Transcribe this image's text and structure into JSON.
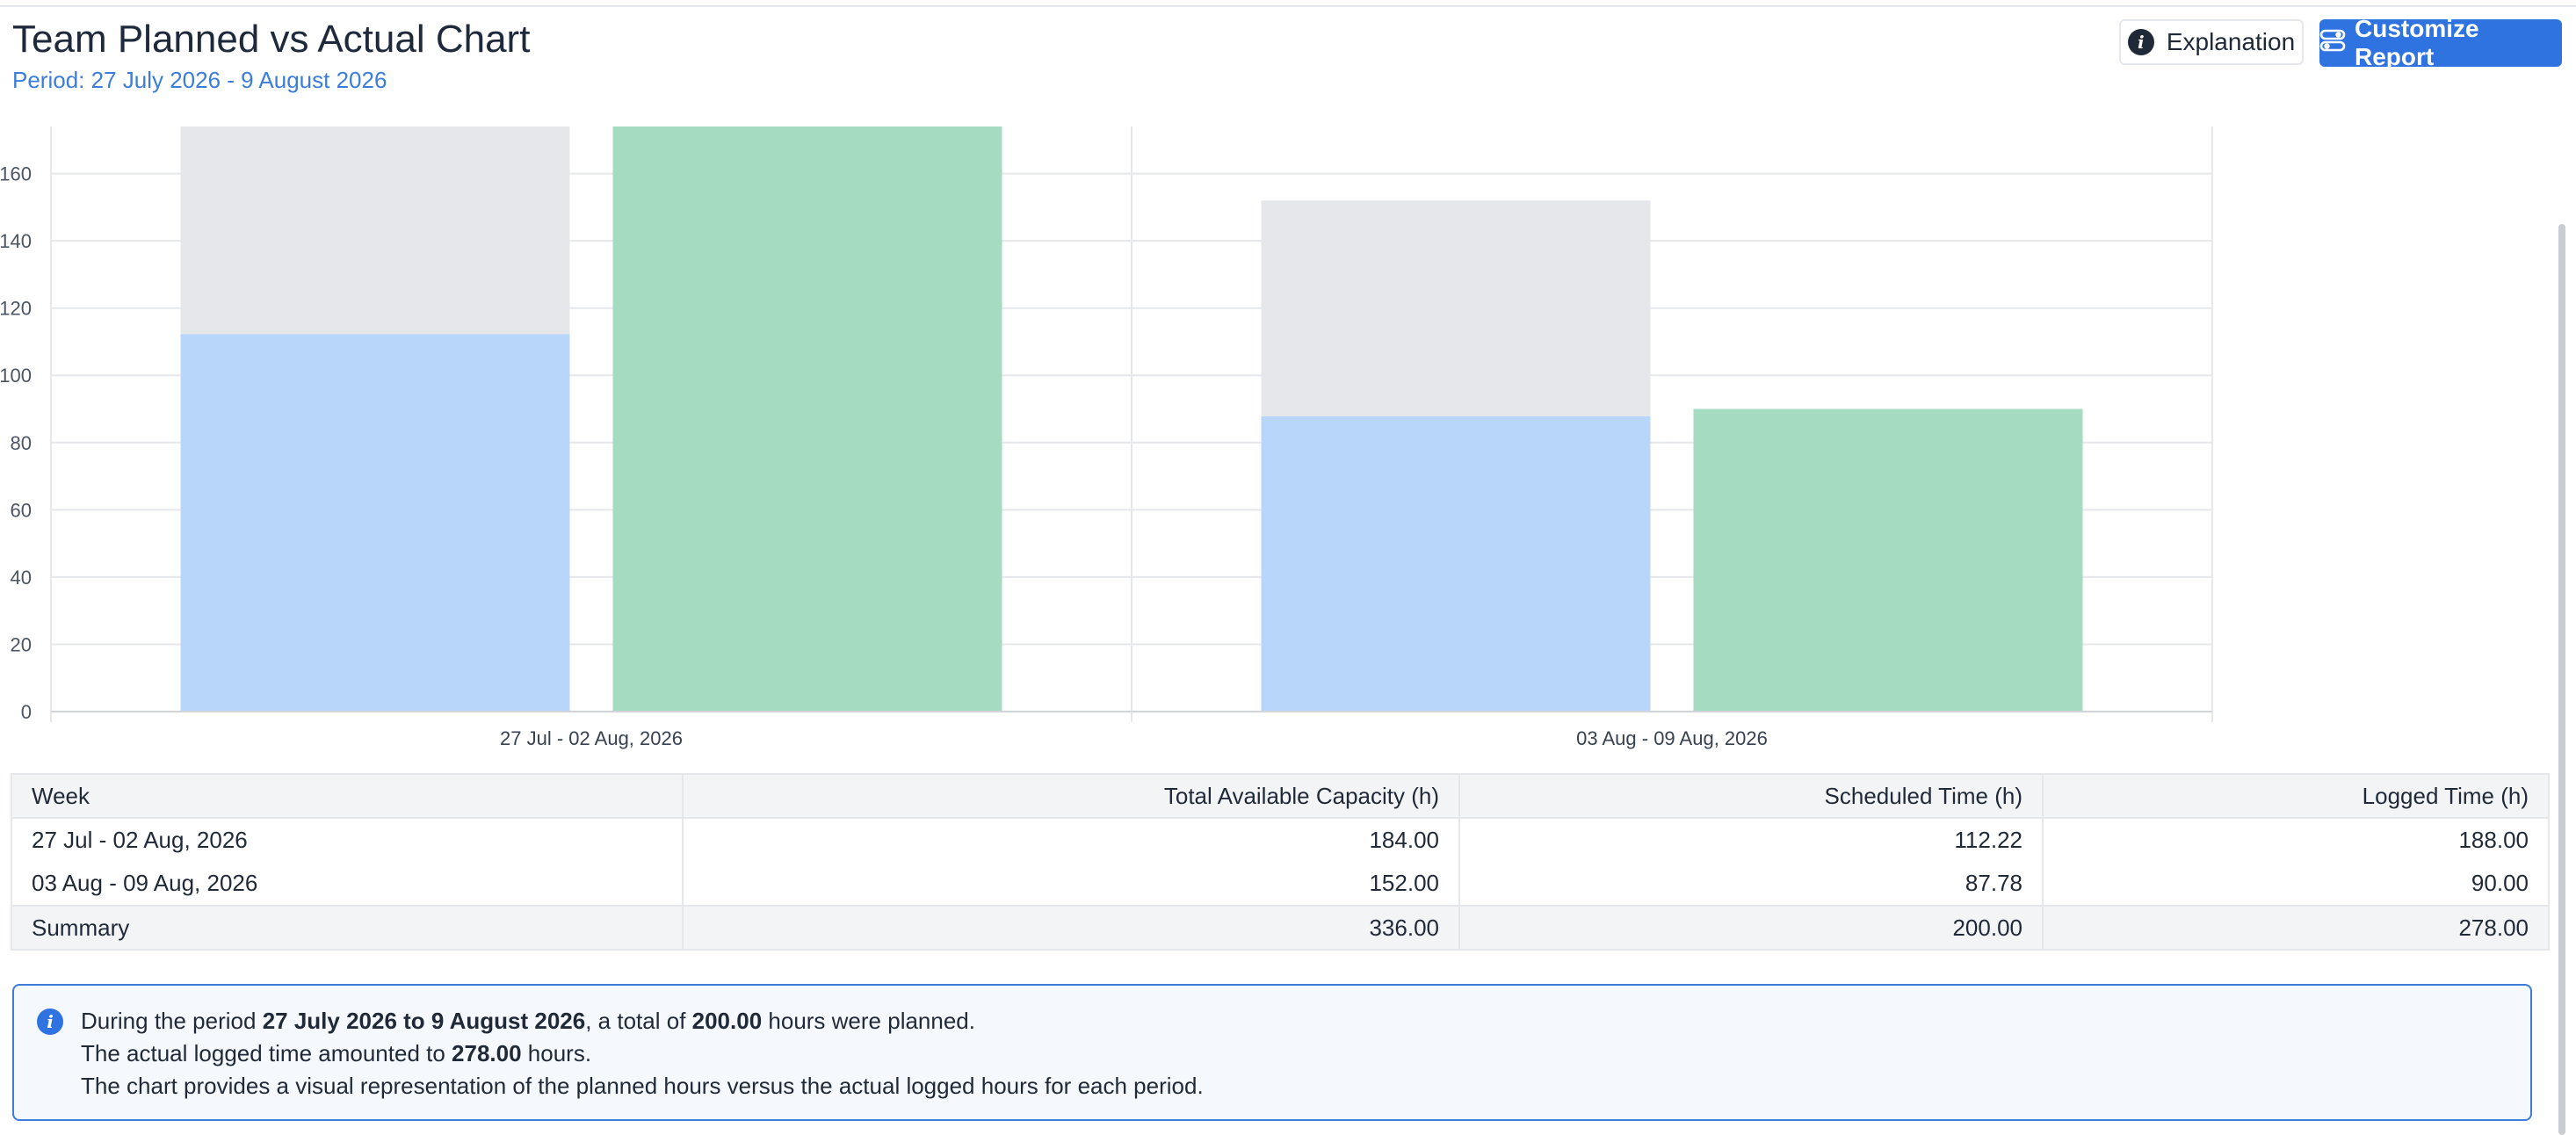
{
  "header": {
    "title": "Team Planned vs Actual Chart",
    "period": "Period: 27 July 2026 - 9 August 2026",
    "explanation_label": "Explanation",
    "customize_label": "Customize Report"
  },
  "colors": {
    "capacity": "#e5e7eb",
    "scheduled": "#b8d5fa",
    "logged": "#a5dbc0",
    "accent": "#2f73e0"
  },
  "chart_data": {
    "type": "bar",
    "categories": [
      "27 Jul - 02 Aug, 2026",
      "03 Aug - 09 Aug, 2026"
    ],
    "series": [
      {
        "key": "capacity",
        "values": [
          184,
          152
        ]
      },
      {
        "key": "scheduled",
        "values": [
          112.22,
          87.78
        ]
      },
      {
        "key": "logged",
        "values": [
          188,
          90
        ]
      }
    ],
    "y_ticks": [
      0,
      20,
      40,
      60,
      80,
      100,
      120,
      140,
      160
    ],
    "ylim": [
      0,
      174
    ],
    "grid": true,
    "title": "",
    "xlabel": "",
    "ylabel": ""
  },
  "table": {
    "headers": [
      "Week",
      "Total Available Capacity (h)",
      "Scheduled Time (h)",
      "Logged Time (h)"
    ],
    "rows": [
      [
        "27 Jul - 02 Aug, 2026",
        "184.00",
        "112.22",
        "188.00"
      ],
      [
        "03 Aug - 09 Aug, 2026",
        "152.00",
        "87.78",
        "90.00"
      ]
    ],
    "summary": [
      "Summary",
      "336.00",
      "200.00",
      "278.00"
    ]
  },
  "note": {
    "line1_prefix": "During the period ",
    "line1_period": "27 July 2026 to 9 August 2026",
    "line1_mid": ", a total of ",
    "line1_planned": "200.00",
    "line1_suffix": " hours were planned.",
    "line2_prefix": "The actual logged time amounted to ",
    "line2_logged": "278.00",
    "line2_suffix": " hours.",
    "line3": "The chart provides a visual representation of the planned hours versus the actual logged hours for each period."
  }
}
